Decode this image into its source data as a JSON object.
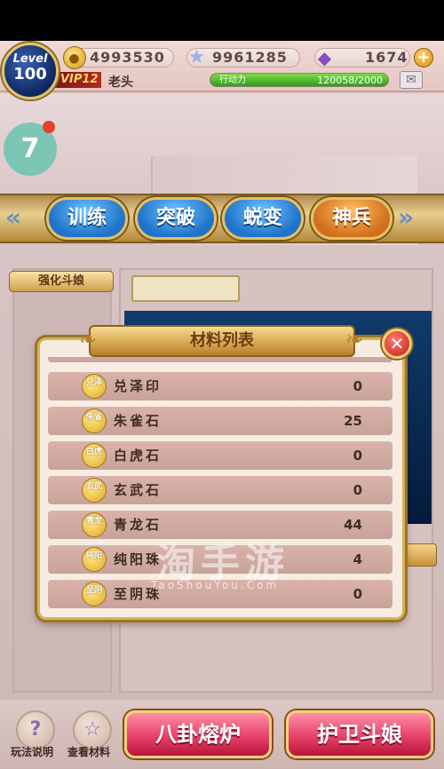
{
  "status": {
    "level_label": "Level",
    "level": "100",
    "gold": "4993530",
    "stars": "9961285",
    "gems": "1674",
    "vip": "VIP12",
    "player_name": "老头",
    "energy_label": "行动力",
    "energy_value": "120058/2000",
    "energy_fill": 1.0
  },
  "notification_badge": "7",
  "tabs": [
    {
      "label": "训练",
      "active": false
    },
    {
      "label": "突破",
      "active": false
    },
    {
      "label": "蜕变",
      "active": false
    },
    {
      "label": "神兵",
      "active": true
    }
  ],
  "left_panel_title": "强化斗娘",
  "modal": {
    "title": "材料列表",
    "items": [
      {
        "badge": "兑泽",
        "name": "兑泽印",
        "qty": "0"
      },
      {
        "badge": "朱雀",
        "name": "朱雀石",
        "qty": "25"
      },
      {
        "badge": "白虎",
        "name": "白虎石",
        "qty": "0"
      },
      {
        "badge": "玄武",
        "name": "玄武石",
        "qty": "0"
      },
      {
        "badge": "青龙",
        "name": "青龙石",
        "qty": "44"
      },
      {
        "badge": "纯阳",
        "name": "纯阳珠",
        "qty": "4"
      },
      {
        "badge": "至阴",
        "name": "至阴珠",
        "qty": "0"
      }
    ]
  },
  "watermark": {
    "main": "淘手游",
    "sub": "TaoShouYou.Com"
  },
  "bottom": {
    "help_label": "玩法说明",
    "materials_label": "查看材料",
    "furnace_button": "八卦熔炉",
    "guard_button": "护卫斗娘"
  },
  "colors": {
    "accent_gold": "#d8b25b",
    "tab_blue": "#1f73c9",
    "tab_active": "#d36f1c",
    "button_pink": "#e33b63"
  }
}
